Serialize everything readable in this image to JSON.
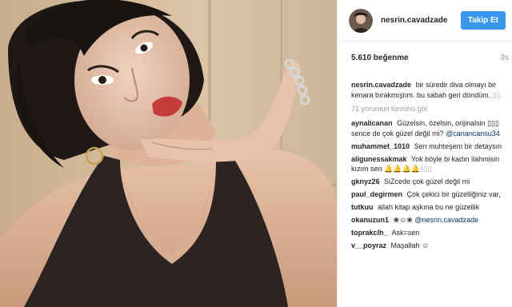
{
  "post": {
    "username": "nesrin.cavadzade",
    "follow_label": "Takip Et",
    "likes": "5.610 beğenme",
    "time": "3s"
  },
  "caption": {
    "username": "nesrin.cavadzade",
    "text": "bir süredir diva olmayı bir kenara bırakmıştım. bu sabah geri döndüm.",
    "emoji": "▯▯"
  },
  "view_all": "71 yorumun tümünü gör",
  "comments": [
    {
      "username": "aynalicanan",
      "text": "Güzelsin, özelsin, orijinalsin ▯▯▯ sence de çok güzel değil mi?",
      "mention": "@canancansu34"
    },
    {
      "username": "muhammet_1010",
      "text": "Sen muhteşem bir detaysın"
    },
    {
      "username": "aligunessakmak",
      "text": "Yok böyle bi kadın ilahmisin kızım sen",
      "emoji": "🔔🔔🔔🔔▯▯▯"
    },
    {
      "username": "gknyz26",
      "text": "SiZcede çok güzel değil mi"
    },
    {
      "username": "paul_degirmen",
      "text": "Çok çekici bir güzelliğiniz var,"
    },
    {
      "username": "tutkuu",
      "text": "allah kitap aşkına bu ne güzellik"
    },
    {
      "username": "okanuzun1",
      "text": "❀☺❀",
      "mention": "@nesrin.cavadzade"
    },
    {
      "username": "toprakclh_",
      "text": "Ask=sen"
    },
    {
      "username": "v__poyraz",
      "text": "Maşallah ☺"
    }
  ],
  "icons": {
    "avatar": "profile-avatar",
    "photo": "post-photo"
  },
  "colors": {
    "follow_button": "#3897f0",
    "mention": "#003569",
    "muted": "#999999"
  }
}
